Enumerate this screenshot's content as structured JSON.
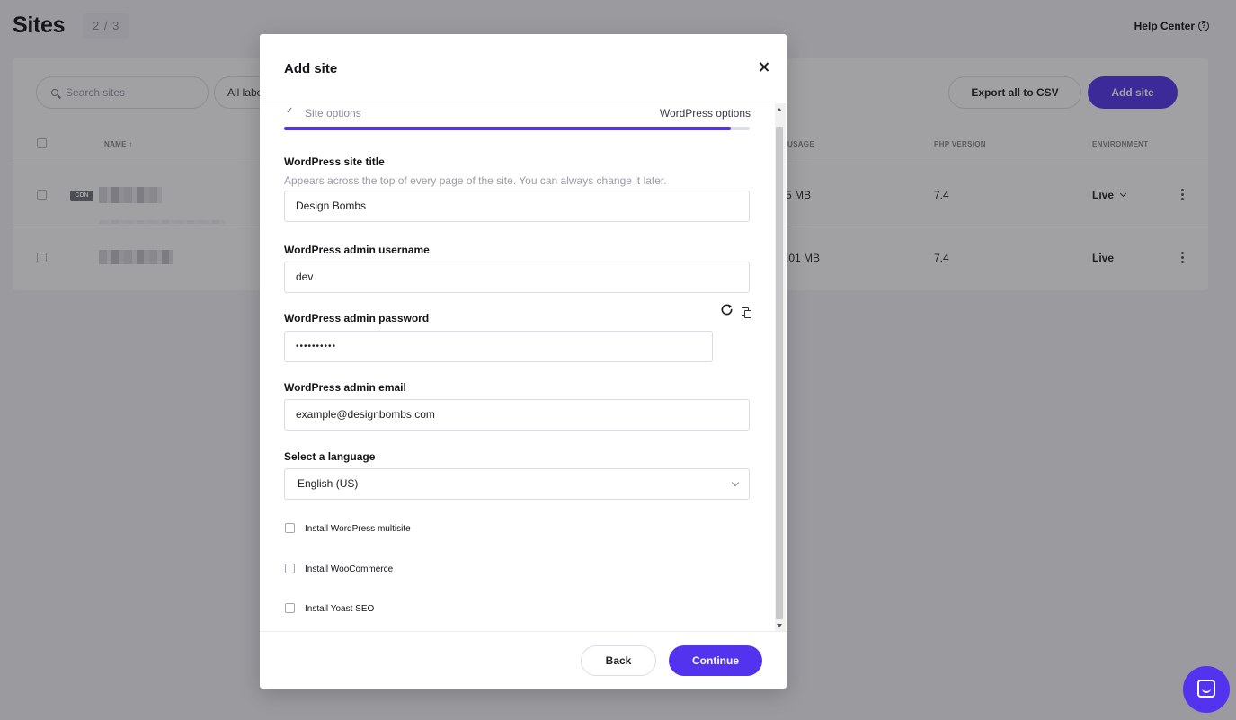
{
  "page": {
    "title": "Sites",
    "site_count": "2 / 3",
    "help_center": "Help Center",
    "help_icon_glyph": "?"
  },
  "toolbar": {
    "search_placeholder": "Search sites",
    "labels_filter": "All labels",
    "export_label": "Export all to CSV",
    "add_site_label": "Add site"
  },
  "table": {
    "columns": {
      "name": "NAME ↑",
      "usage": "USAGE",
      "php_version": "PHP VERSION",
      "environment": "ENVIRONMENT"
    },
    "rows": [
      {
        "cdn_badge": "CDN",
        "usage": "5 MB",
        "php_version": "7.4",
        "environment": "Live"
      },
      {
        "usage": ".01 MB",
        "php_version": "7.4",
        "environment": "Live"
      }
    ]
  },
  "modal": {
    "title": "Add site",
    "steps": {
      "check_glyph": "✓",
      "step1": "Site options",
      "step2": "WordPress options",
      "progress": 0.96
    },
    "fields": {
      "site_title": {
        "label": "WordPress site title",
        "help": "Appears across the top of every page of the site. You can always change it later.",
        "value": "Design Bombs"
      },
      "admin_username": {
        "label": "WordPress admin username",
        "value": "dev"
      },
      "admin_password": {
        "label": "WordPress admin password",
        "value": "••••••••••"
      },
      "admin_email": {
        "label": "WordPress admin email",
        "value": "example@designbombs.com"
      },
      "language": {
        "label": "Select a language",
        "value": "English (US)"
      }
    },
    "checkboxes": {
      "multisite": "Install WordPress multisite",
      "woocommerce": "Install WooCommerce",
      "yoast": "Install Yoast SEO"
    },
    "footer": {
      "back": "Back",
      "continue": "Continue"
    }
  },
  "colors": {
    "accent": "#5333ed"
  }
}
